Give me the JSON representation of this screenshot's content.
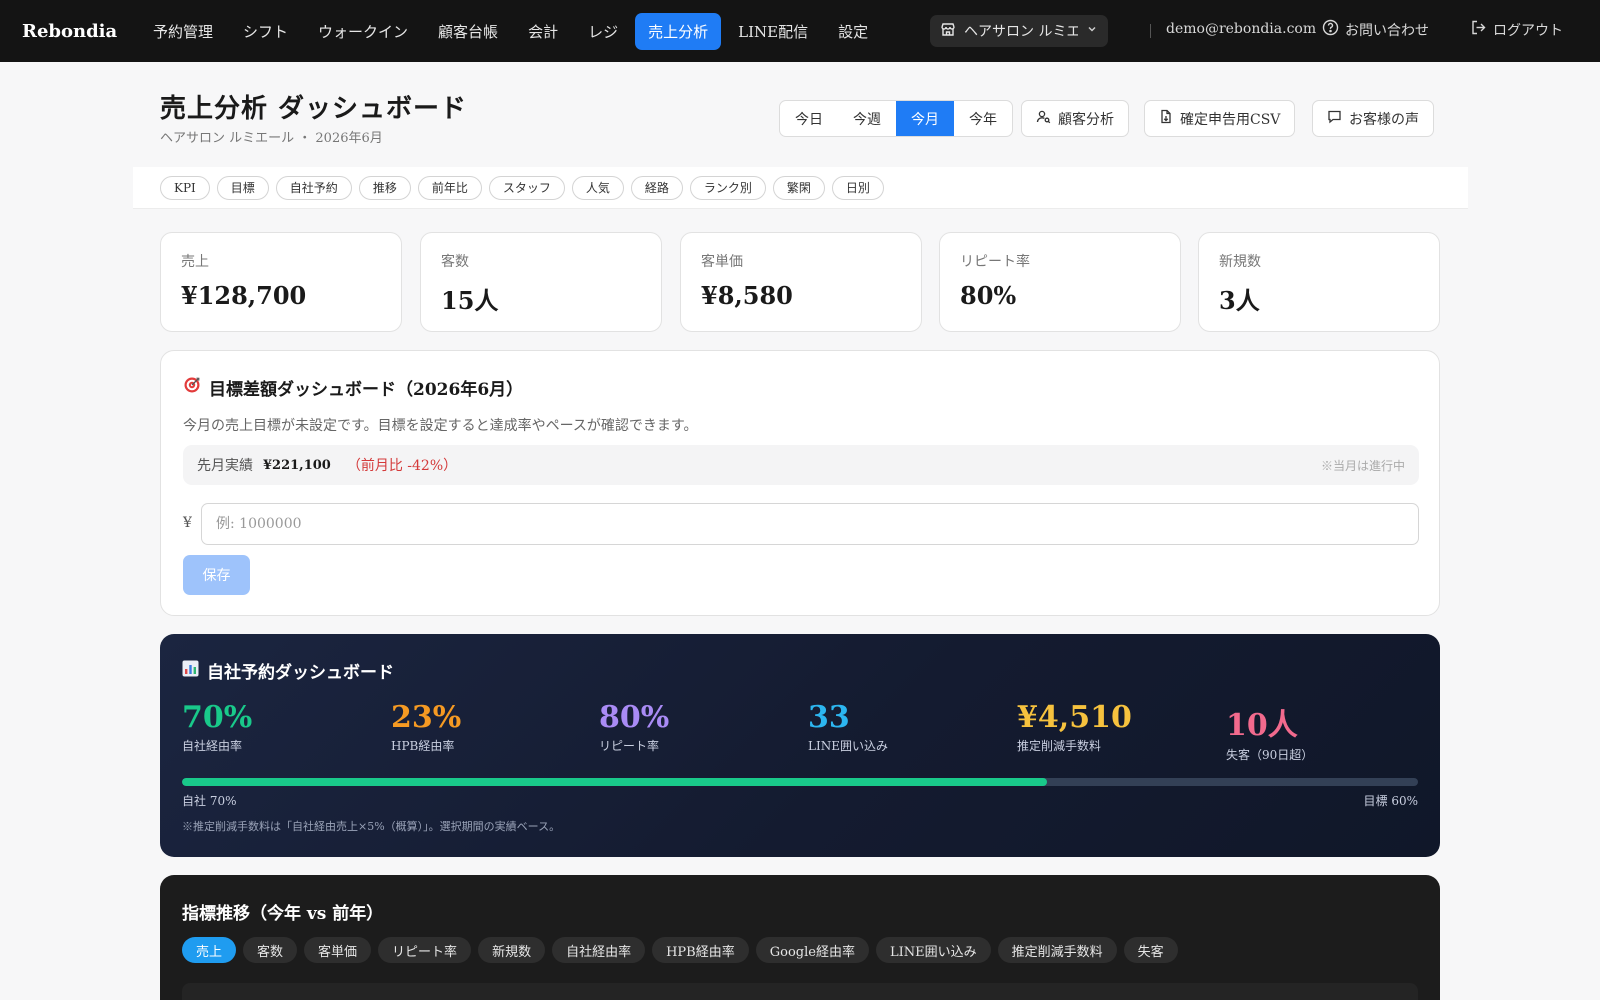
{
  "nav": {
    "brand": "Rebondia",
    "items": [
      {
        "label": "予約管理",
        "active": false
      },
      {
        "label": "シフト",
        "active": false
      },
      {
        "label": "ウォークイン",
        "active": false
      },
      {
        "label": "顧客台帳",
        "active": false
      },
      {
        "label": "会計",
        "active": false
      },
      {
        "label": "レジ",
        "active": false
      },
      {
        "label": "売上分析",
        "active": true
      },
      {
        "label": "LINE配信",
        "active": false
      },
      {
        "label": "設定",
        "active": false
      }
    ],
    "shop": "ヘアサロン ルミエ...",
    "email": "demo@rebondia.com",
    "help": "お問い合わせ",
    "logout": "ログアウト"
  },
  "header": {
    "title": "売上分析 ダッシュボード",
    "subtitle": "ヘアサロン ルミエール ・ 2026年6月",
    "periods": [
      {
        "label": "今日",
        "active": false
      },
      {
        "label": "今週",
        "active": false
      },
      {
        "label": "今月",
        "active": true
      },
      {
        "label": "今年",
        "active": false
      }
    ],
    "customer_analysis": "顧客分析",
    "tax_csv": "確定申告用CSV",
    "voice": "お客様の声"
  },
  "chips": [
    "KPI",
    "目標",
    "自社予約",
    "推移",
    "前年比",
    "スタッフ",
    "人気",
    "経路",
    "ランク別",
    "繁閑",
    "日別"
  ],
  "kpis": [
    {
      "label": "売上",
      "value": "¥128,700"
    },
    {
      "label": "客数",
      "value": "15人"
    },
    {
      "label": "客単価",
      "value": "¥8,580"
    },
    {
      "label": "リピート率",
      "value": "80%"
    },
    {
      "label": "新規数",
      "value": "3人"
    }
  ],
  "target": {
    "title": "目標差額ダッシュボード（2026年6月）",
    "description": "今月の売上目標が未設定です。目標を設定すると達成率やペースが確認できます。",
    "prev_label": "先月実績",
    "prev_value": "¥221,100",
    "prev_ratio": "（前月比 -42%）",
    "note": "※当月は進行中",
    "currency": "¥",
    "input_placeholder": "例: 1000000",
    "save_label": "保存"
  },
  "own": {
    "title": "自社予約ダッシュボード",
    "metrics": [
      {
        "value": "70%",
        "label": "自社経由率",
        "color": "#19c98a"
      },
      {
        "value": "23%",
        "label": "HPB経由率",
        "color": "#f59a23"
      },
      {
        "value": "80%",
        "label": "リピート率",
        "color": "#a98bf5"
      },
      {
        "value": "33",
        "label": "LINE囲い込み",
        "color": "#2cb6f0"
      },
      {
        "value": "¥4,510",
        "label": "推定削減手数料",
        "color": "#f6c23e"
      },
      {
        "value": "10人",
        "label": "失客（90日超）",
        "color": "#f26a8d"
      }
    ],
    "progress": 0.7,
    "bar_left": "自社 70%",
    "bar_right": "目標 60%",
    "note": "※推定削減手数料は「自社経由売上×5%（概算）」。選択期間の実績ベース。"
  },
  "trend": {
    "title": "指標推移（今年 vs 前年）",
    "tabs": [
      {
        "label": "売上",
        "active": true
      },
      {
        "label": "客数",
        "active": false
      },
      {
        "label": "客単価",
        "active": false
      },
      {
        "label": "リピート率",
        "active": false
      },
      {
        "label": "新規数",
        "active": false
      },
      {
        "label": "自社経由率",
        "active": false
      },
      {
        "label": "HPB経由率",
        "active": false
      },
      {
        "label": "Google経由率",
        "active": false
      },
      {
        "label": "LINE囲い込み",
        "active": false
      },
      {
        "label": "推定削減手数料",
        "active": false
      },
      {
        "label": "失客",
        "active": false
      }
    ]
  }
}
